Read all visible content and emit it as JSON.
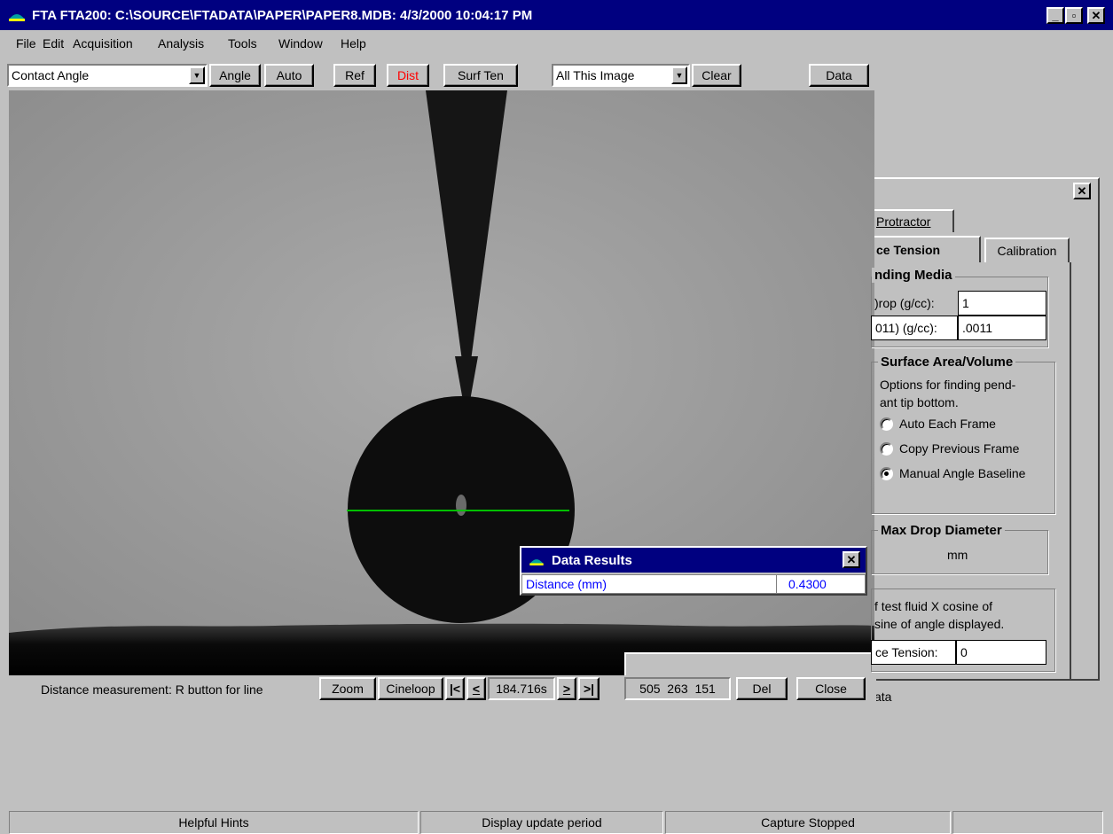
{
  "window": {
    "title": "FTA FTA200: C:\\SOURCE\\FTADATA\\PAPER\\PAPER8.MDB: 4/3/2000 10:04:17 PM",
    "min_label": "_",
    "max_label": "▫",
    "close_label": "✕"
  },
  "menu": [
    "File",
    "Edit",
    "Acquisition",
    "Analysis",
    "Tools",
    "Window",
    "Help"
  ],
  "toolbar": {
    "mode_value": "Contact Angle",
    "angle": "Angle",
    "auto": "Auto",
    "ref": "Ref",
    "dist": "Dist",
    "surf_ten": "Surf Ten",
    "scope_value": "All This Image",
    "clear": "Clear",
    "data": "Data",
    "dist_color": "#ff0000"
  },
  "image": {
    "baseline_color": "#00c000"
  },
  "panel": {
    "close_label": "✕",
    "tabs": {
      "protractor": "Protractor",
      "surface_tension": "ce Tension",
      "calibration": "Calibration"
    },
    "media_group": "nding Media",
    "drop_label": ")rop (g/cc):",
    "drop_value": "1",
    "media_label": "011) (g/cc):",
    "media_value": ".0011",
    "sav_group": "Surface Area/Volume",
    "sav_desc": "Options for finding pend-\nant tip bottom.",
    "opt_auto": "Auto Each Frame",
    "opt_copy": "Copy Previous Frame",
    "opt_manual": "Manual Angle Baseline",
    "max_drop_group": "Max Drop Diameter",
    "max_drop_unit": "mm",
    "cos_line1": "f test fluid X cosine of",
    "cos_line2": "sine of angle displayed.",
    "tension_label": "ce Tension:",
    "tension_value": "0",
    "behind_text": "ata"
  },
  "data_results": {
    "title": "Data Results",
    "close_label": "✕",
    "row_label": "Distance (mm)",
    "row_value": "0.4300",
    "text_color": "#0000ff"
  },
  "bottom": {
    "hint": "Distance measurement: R button for line",
    "zoom": "Zoom",
    "cineloop": "Cineloop",
    "first": "|<",
    "prev": "<",
    "time": "184.716s",
    "next": ">",
    "last": ">|",
    "coords": "505  263  151",
    "del": "Del",
    "close": "Close"
  },
  "status": {
    "hints": "Helpful Hints",
    "update": "Display update period",
    "capture": "Capture Stopped"
  }
}
